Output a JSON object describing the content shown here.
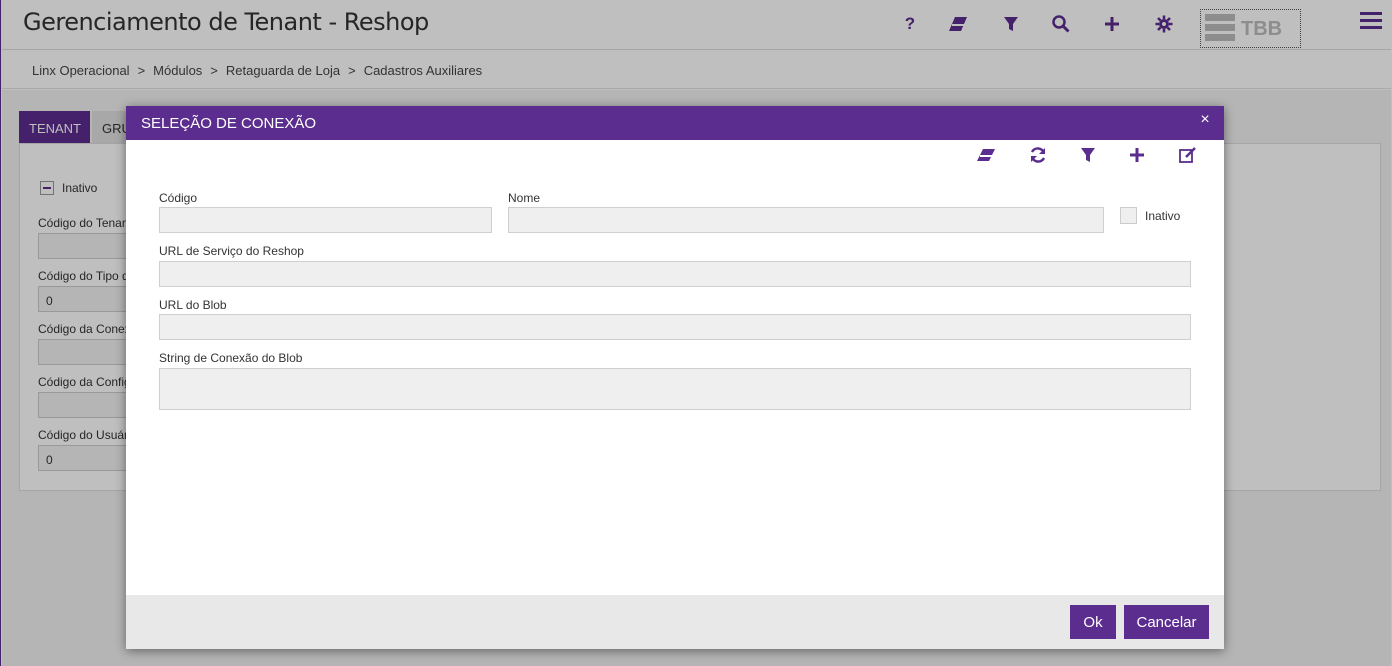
{
  "header": {
    "title": "Gerenciamento de Tenant - Reshop",
    "icons": [
      "help-icon",
      "eraser-icon",
      "filter-icon",
      "search-icon",
      "plus-icon",
      "gear-icon",
      "menu-icon"
    ],
    "help_glyph": "?",
    "logo_text": "TBB"
  },
  "breadcrumb": {
    "items": [
      "Linx Operacional",
      "Módulos",
      "Retaguarda de Loja",
      "Cadastros Auxiliares"
    ],
    "separator": ">"
  },
  "tabs": {
    "active_label": "TENANT",
    "second_label": "GRU"
  },
  "background_form": {
    "inativo_label": "Inativo",
    "fields": [
      {
        "label": "Código do Tenant",
        "value": ""
      },
      {
        "label": "Código do Tipo d",
        "value": "0"
      },
      {
        "label": "Código da Conex",
        "value": ""
      },
      {
        "label": "Código da Config",
        "value": ""
      },
      {
        "label": "Código do Usuár",
        "value": "0"
      }
    ]
  },
  "modal": {
    "title": "SELEÇÃO DE CONEXÃO",
    "close_glyph": "×",
    "toolbar_icons": [
      "eraser-icon",
      "refresh-icon",
      "filter-icon",
      "plus-icon",
      "edit-icon"
    ],
    "fields": {
      "codigo": {
        "label": "Código",
        "value": ""
      },
      "nome": {
        "label": "Nome",
        "value": ""
      },
      "inativo": {
        "label": "Inativo",
        "checked": false
      },
      "url_servico": {
        "label": "URL de Serviço do Reshop",
        "value": ""
      },
      "url_blob": {
        "label": "URL do Blob",
        "value": ""
      },
      "string_conexao": {
        "label": "String de Conexão do Blob",
        "value": ""
      }
    },
    "buttons": {
      "ok": "Ok",
      "cancel": "Cancelar"
    }
  },
  "colors": {
    "brand": "#5b2d8e",
    "footer": "#e8e8e8",
    "field_bg": "#efefef"
  }
}
